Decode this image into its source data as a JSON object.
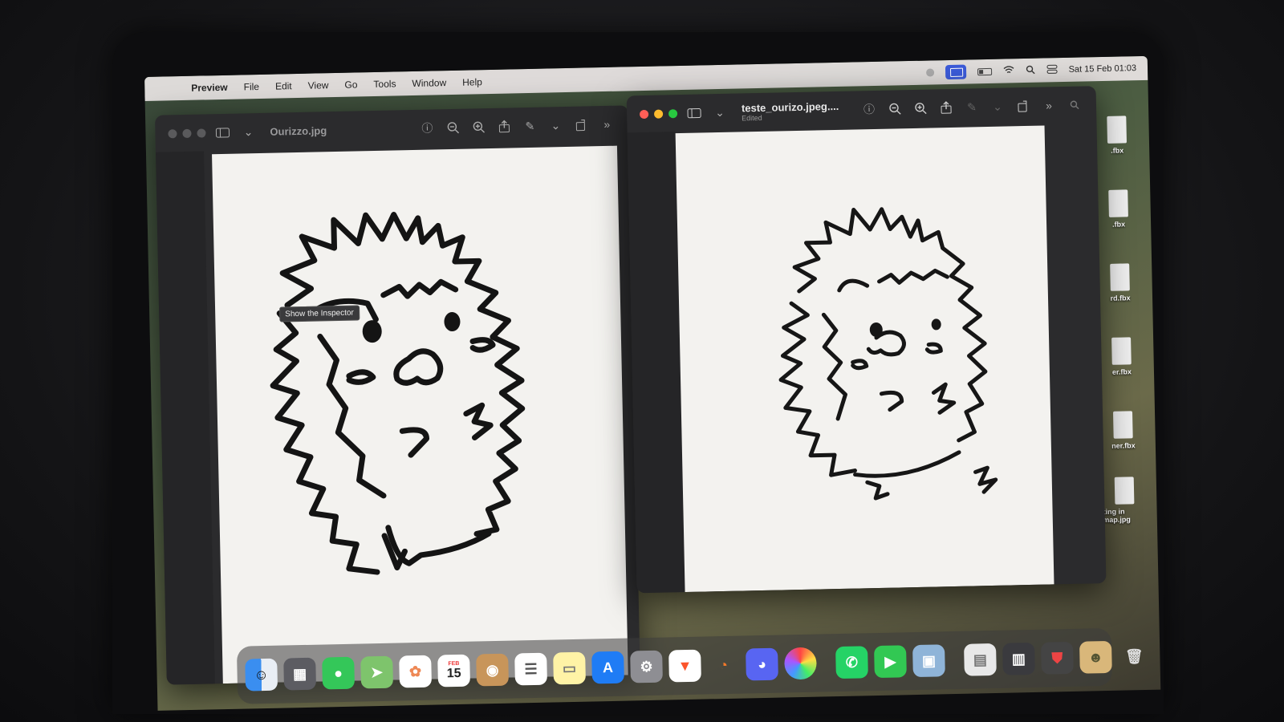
{
  "menubar": {
    "app_name": "Preview",
    "menus": [
      "File",
      "Edit",
      "View",
      "Go",
      "Tools",
      "Window",
      "Help"
    ],
    "datetime": "Sat 15 Feb 01:03"
  },
  "window_left": {
    "title": "Ourizzo.jpg",
    "tooltip": "Show the Inspector"
  },
  "window_right": {
    "title": "teste_ourizo.jpeg....",
    "subtitle": "Edited"
  },
  "desktop_files": [
    ".fbx",
    ".fbx",
    "rd.fbx",
    "er.fbx",
    "ner.fbx",
    "ipting in ...map.jpg"
  ],
  "dock": {
    "calendar_month": "FEB",
    "calendar_day": "15",
    "apps": [
      "finder",
      "launchpad",
      "messages",
      "maps",
      "photos",
      "calendar",
      "contacts",
      "reminders",
      "notes",
      "app-store",
      "system-settings",
      "brave",
      "blender",
      "discord",
      "color-picker",
      "whatsapp",
      "facetime",
      "preview",
      "document",
      "screenshots",
      "shield-app",
      "avatar-app",
      "trash"
    ]
  },
  "colors": {
    "accent_blue": "#3b5bd9",
    "red_light": "#ff5f57",
    "yellow_light": "#febc2e",
    "green_light": "#28c840"
  }
}
